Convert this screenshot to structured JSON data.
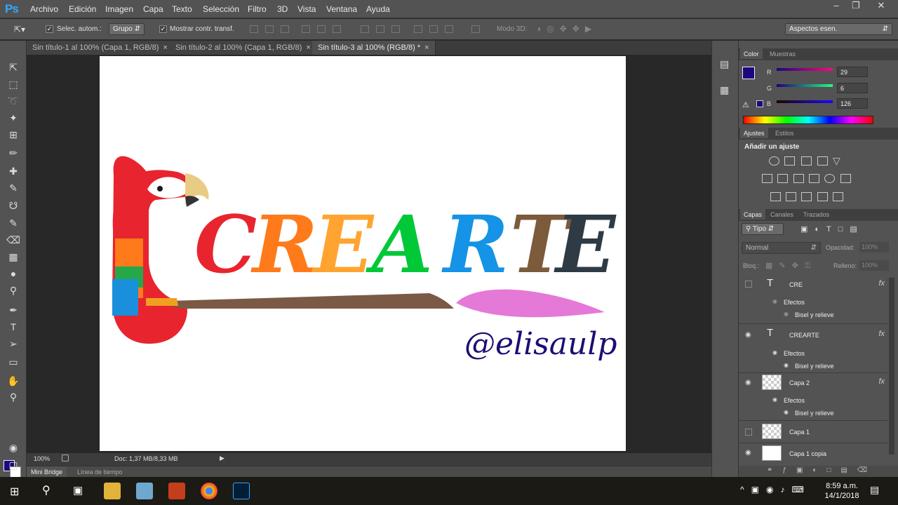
{
  "app": {
    "logo": "Ps"
  },
  "menu": [
    "Archivo",
    "Edición",
    "Imagen",
    "Capa",
    "Texto",
    "Selección",
    "Filtro",
    "3D",
    "Vista",
    "Ventana",
    "Ayuda"
  ],
  "window_controls": [
    "–",
    "❐",
    "✕"
  ],
  "options": {
    "auto_select_label": "Selec. autom.:",
    "auto_select_value": "Grupo",
    "show_transform_label": "Mostrar contr. transf.",
    "mode3d_label": "Modo 3D:",
    "workspace_value": "Aspectos esen."
  },
  "doc_tabs": [
    {
      "label": "Sin título-1 al 100% (Capa 1, RGB/8)",
      "close": "×"
    },
    {
      "label": "Sin título-2 al 100% (Capa 1, RGB/8)",
      "close": "×"
    },
    {
      "label": "Sin título-3 al 100% (RGB/8) *",
      "close": "×"
    }
  ],
  "canvas": {
    "title_letters": [
      "C",
      "R",
      "E",
      "A",
      "R",
      "T",
      "E"
    ],
    "letter_colors": [
      "#e8242f",
      "#e8242f",
      "#ff7a1a",
      "#ffa431",
      "#00c837",
      "#1593e6",
      "#7c5a3c",
      "#2f3b44"
    ],
    "handle": "@elisaulp",
    "handle_color": "#1b0f73"
  },
  "status": {
    "zoom": "100%",
    "doc": "Doc: 1,37 MB/8,33 MB"
  },
  "bottom_tabs": [
    "Mini Bridge",
    "Línea de tiempo"
  ],
  "color_panel": {
    "tabs": [
      "Color",
      "Muestras"
    ],
    "r_label": "R",
    "r": "29",
    "g_label": "G",
    "g": "6",
    "b_label": "B",
    "b": "126",
    "fg_color": "#1d067e"
  },
  "adjust_panel": {
    "tabs": [
      "Ajustes",
      "Estilos"
    ],
    "heading": "Añadir un ajuste"
  },
  "layers_panel": {
    "tabs": [
      "Capas",
      "Canales",
      "Trazados"
    ],
    "filter_value": "Tipo",
    "blend_mode": "Normal",
    "opacity_label": "Opacidad:",
    "opacity_value": "100%",
    "lock_label": "Bloq.:",
    "fill_label": "Relleno:",
    "fill_value": "100%",
    "layers": [
      {
        "name": "CRE",
        "type": "T",
        "fx": "fx",
        "effects_label": "Efectos",
        "effect": "Bisel y relieve",
        "visible": false
      },
      {
        "name": "CREARTE",
        "type": "T",
        "fx": "fx",
        "effects_label": "Efectos",
        "effect": "Bisel y relieve",
        "visible": true
      },
      {
        "name": "Capa 2",
        "type": "img",
        "fx": "fx",
        "effects_label": "Efectos",
        "effect": "Bisel y relieve",
        "visible": true
      },
      {
        "name": "Capa 1",
        "type": "img",
        "visible": false
      },
      {
        "name": "Capa 1 copia",
        "type": "img",
        "visible": true
      }
    ]
  },
  "taskbar": {
    "time": "8:59 a.m.",
    "date": "14/1/2018"
  }
}
